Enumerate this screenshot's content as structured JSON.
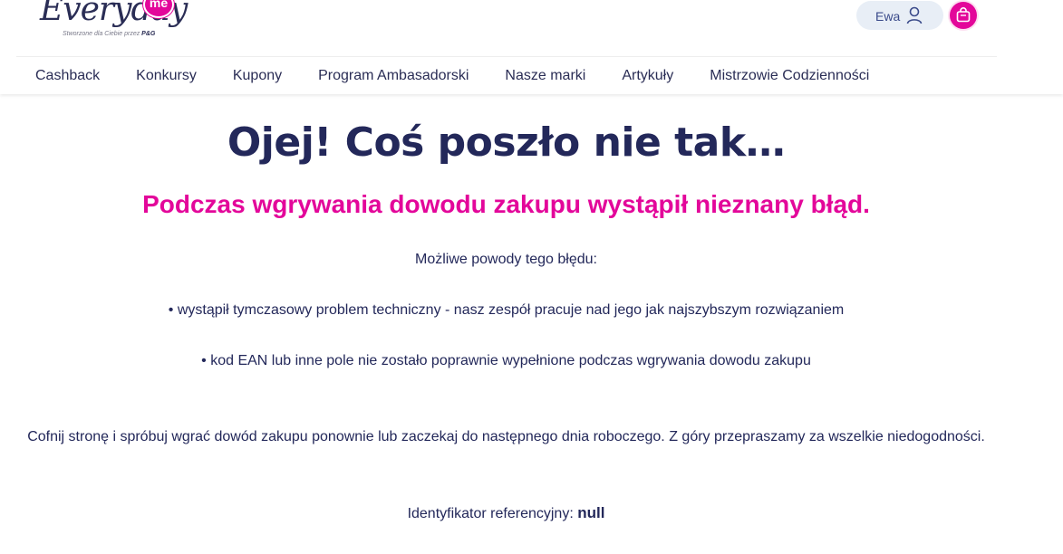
{
  "header": {
    "logo": {
      "word": "Everyday",
      "badge": "me",
      "tagline": "Stworzone dla Ciebie przez",
      "tagline_brand": "P&G"
    },
    "user": {
      "name": "Ewa"
    },
    "icons": {
      "user": "user-icon",
      "bag": "shopping-bag-icon"
    },
    "colors": {
      "accent": "#e3079a",
      "navy": "#23285a",
      "pill": "#e8eef6"
    }
  },
  "nav": {
    "items": [
      {
        "label": "Cashback"
      },
      {
        "label": "Konkursy"
      },
      {
        "label": "Kupony"
      },
      {
        "label": "Program Ambasadorski"
      },
      {
        "label": "Nasze marki"
      },
      {
        "label": "Artykuły"
      },
      {
        "label": "Mistrzowie Codzienności"
      }
    ]
  },
  "error": {
    "title": "Ojej! Coś poszło nie tak…",
    "subtitle": "Podczas wgrywania dowodu zakupu wystąpił nieznany błąd.",
    "reasons_intro": "Możliwe powody tego błędu:",
    "reasons": [
      "• wystąpił tymczasowy problem techniczny - nasz zespół pracuje nad jego jak najszybszym rozwiązaniem",
      "• kod EAN lub inne pole nie zostało poprawnie wypełnione podczas wgrywania dowodu zakupu"
    ],
    "advice": "Cofnij stronę i spróbuj wgrać dowód zakupu ponownie lub zaczekaj do następnego dnia roboczego. Z góry przepraszamy za wszelkie niedogodności.",
    "reference_label": "Identyfikator referencyjny:",
    "reference_value": "null"
  }
}
